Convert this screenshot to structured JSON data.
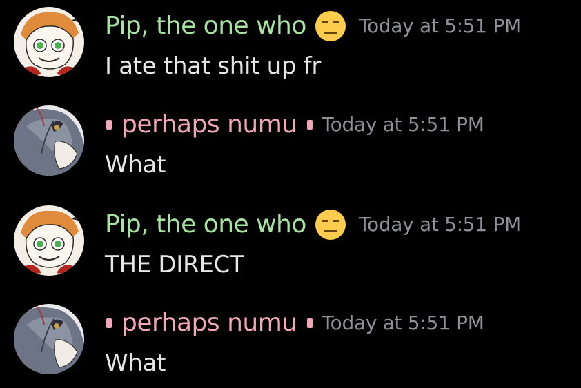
{
  "colors": {
    "pip_name": "#a6e3a1",
    "numu_name": "#f2a7b8",
    "timestamp": "#8e9297",
    "text": "#e6e6e6"
  },
  "messages": [
    {
      "author": "Pip, the one who",
      "author_emoji": "expressionless-face-icon",
      "timestamp": "Today at 5:51 PM",
      "text": "I ate that shit up fr"
    },
    {
      "author": "perhaps numu",
      "timestamp": "Today at 5:51 PM",
      "text": "What"
    },
    {
      "author": "Pip, the one who",
      "author_emoji": "expressionless-face-icon",
      "timestamp": "Today at 5:51 PM",
      "text": "THE DIRECT"
    },
    {
      "author": "perhaps numu",
      "timestamp": "Today at 5:51 PM",
      "text": "What"
    }
  ]
}
